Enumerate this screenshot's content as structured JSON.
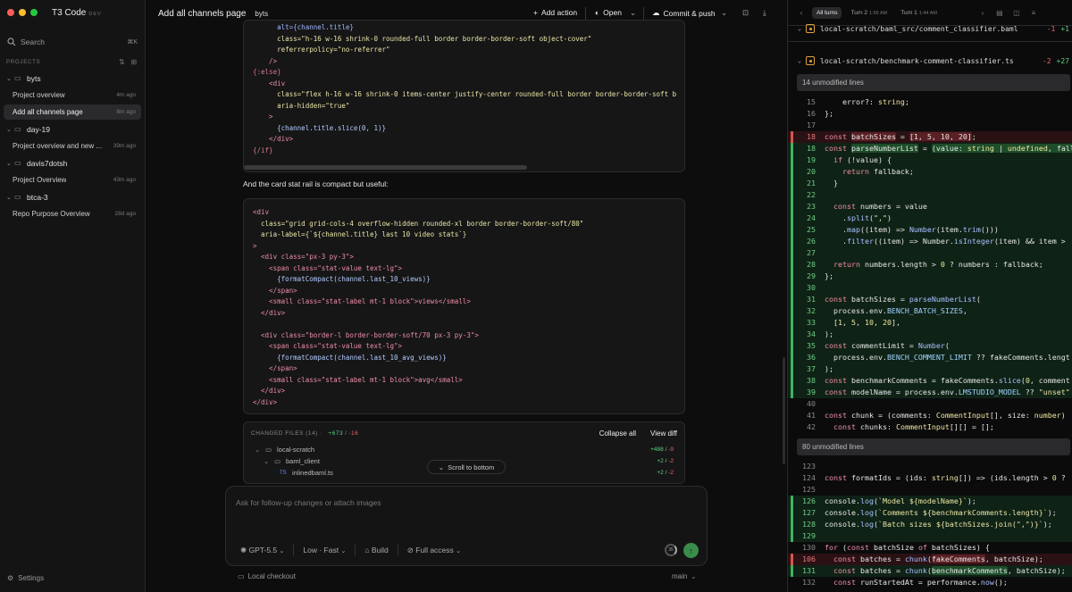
{
  "app": {
    "name": "T3 Code",
    "badge": "DEV"
  },
  "sidebar": {
    "search_label": "Search",
    "search_shortcut": "⌘K",
    "projects_label": "PROJECTS",
    "groups": [
      {
        "name": "byts",
        "threads": [
          {
            "title": "Project overview",
            "ago": "4m ago"
          },
          {
            "title": "Add all channels page",
            "ago": "8m ago"
          }
        ]
      },
      {
        "name": "day-19",
        "threads": [
          {
            "title": "Project overview and new ...",
            "ago": "39m ago"
          }
        ]
      },
      {
        "name": "davis7dotsh",
        "threads": [
          {
            "title": "Project Overview",
            "ago": "43m ago"
          }
        ]
      },
      {
        "name": "btca-3",
        "threads": [
          {
            "title": "Repo Purpose Overview",
            "ago": "28d ago"
          }
        ]
      }
    ],
    "settings_label": "Settings"
  },
  "header": {
    "title": "Add all channels page",
    "project": "byts",
    "add_action": "Add action",
    "open": "Open",
    "commit": "Commit & push"
  },
  "chat": {
    "code1": [
      "      alt={channel.title}",
      "      class=\"h-16 w-16 shrink-0 rounded-full border border-border-soft object-cover\"",
      "      referrerpolicy=\"no-referrer\"",
      "    />",
      "{:else}",
      "    <div",
      "      class=\"flex h-16 w-16 shrink-0 items-center justify-center rounded-full border border-border-soft b",
      "      aria-hidden=\"true\"",
      "    >",
      "      {channel.title.slice(0, 1)}",
      "    </div>",
      "{/if}"
    ],
    "prose": "And the card stat rail is compact but useful:",
    "code2": [
      "<div",
      "  class=\"grid grid-cols-4 overflow-hidden rounded-xl border border-border-soft/80\"",
      "  aria-label={`${channel.title} last 10 video stats`}",
      ">",
      "  <div class=\"px-3 py-3\">",
      "    <span class=\"stat-value text-lg\">",
      "      {formatCompact(channel.last_10_views)}",
      "    </span>",
      "    <small class=\"stat-label mt-1 block\">views</small>",
      "  </div>",
      "",
      "  <div class=\"border-l border-border-soft/70 px-3 py-3\">",
      "    <span class=\"stat-value text-lg\">",
      "      {formatCompact(channel.last_10_avg_views)}",
      "    </span>",
      "    <small class=\"stat-label mt-1 block\">avg</small>",
      "  </div>",
      "</div>"
    ],
    "changed": {
      "label": "CHANGED FILES (14)",
      "sep": "·",
      "plus": "+673",
      "slash": "/",
      "minus": "-16",
      "collapse": "Collapse all",
      "view": "View diff",
      "rows": [
        {
          "name": "local-scratch",
          "add": "+488",
          "del": "-9"
        },
        {
          "name": "baml_client",
          "add": "+2",
          "del": "-2"
        },
        {
          "name": "inlinedbaml.ts",
          "add": "+2",
          "del": "-2"
        }
      ]
    },
    "scroll_bottom": "Scroll to bottom",
    "composer": {
      "placeholder": "Ask for follow-up changes or attach images",
      "model": "GPT-5.5",
      "effort": "Low · Fast",
      "mode": "Build",
      "access": "Full access",
      "context": "35"
    },
    "footer": {
      "checkout": "Local checkout",
      "branch": "main"
    }
  },
  "diff": {
    "turns": [
      {
        "label": "All turns",
        "time": ""
      },
      {
        "label": "Turn 2",
        "time": "1:55 AM"
      },
      {
        "label": "Turn 1",
        "time": "1:44 AM"
      }
    ],
    "file1": {
      "path": "local-scratch/baml_src/comment_classifier.baml",
      "del": "-1",
      "add": "+1"
    },
    "file2": {
      "path": "local-scratch/benchmark-comment-classifier.ts",
      "del": "-2",
      "add": "+27"
    },
    "unmodified1": "14 unmodified lines",
    "unmodified2": "80 unmodified lines"
  }
}
